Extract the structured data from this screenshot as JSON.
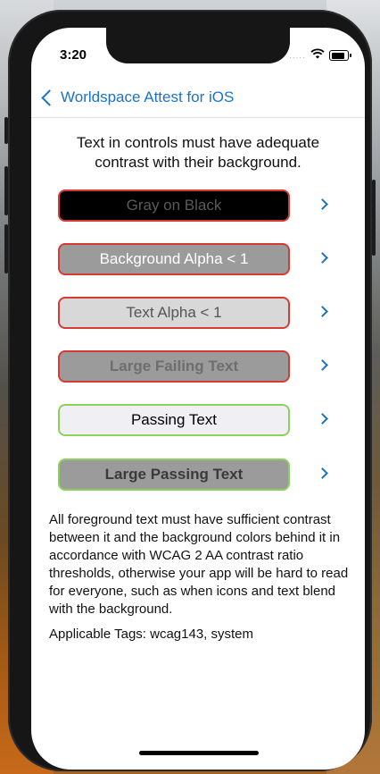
{
  "status_bar": {
    "time": "3:20",
    "signal": "....."
  },
  "nav": {
    "back_label": "Worldspace Attest for iOS"
  },
  "heading": "Text in controls must have adequate contrast with their background.",
  "buttons": [
    {
      "label": "Gray on Black",
      "bg": "#000000",
      "fg": "#5a5a5a",
      "border": "#d63a32",
      "bold": false
    },
    {
      "label": "Background Alpha < 1",
      "bg": "#9b9b9b",
      "fg": "#ffffff",
      "border": "#d63a32",
      "bold": false
    },
    {
      "label": "Text Alpha < 1",
      "bg": "#d8d8d8",
      "fg": "#555555",
      "border": "#d63a32",
      "bold": false
    },
    {
      "label": "Large Failing Text",
      "bg": "#9b9b9b",
      "fg": "#6e6e6e",
      "border": "#d63a32",
      "bold": true
    },
    {
      "label": "Passing Text",
      "bg": "#efeff4",
      "fg": "#000000",
      "border": "#8bd25a",
      "bold": false
    },
    {
      "label": "Large Passing Text",
      "bg": "#9b9b9b",
      "fg": "#3a3a3a",
      "border": "#8bd25a",
      "bold": true
    }
  ],
  "description": "All foreground text must have sufficient contrast between it and the background colors behind it in accordance with WCAG 2 AA contrast ratio thresholds, otherwise your app will be hard to read for everyone, such as when icons and text blend with the background.",
  "tags": "Applicable Tags: wcag143, system",
  "colors": {
    "accent": "#1a73c8",
    "fail": "#d63a32",
    "pass": "#8bd25a"
  }
}
